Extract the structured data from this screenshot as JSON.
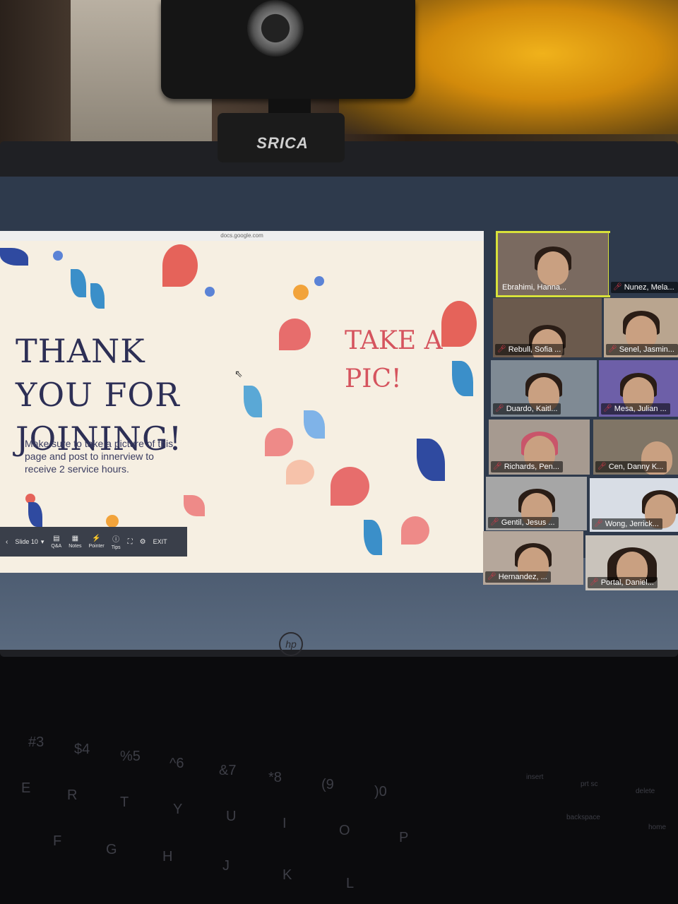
{
  "webcam": {
    "brand": "SRICA"
  },
  "browser": {
    "url": "docs.google.com"
  },
  "slide": {
    "title_lines": [
      "THANK YOU FOR",
      "JOINING!"
    ],
    "side_text_lines": [
      "TAKE A",
      "PIC!"
    ],
    "instructions": "Make sure to take a picture of this page and post to innerview to receive 2 service hours."
  },
  "toolbar": {
    "slide_label": "Slide 10",
    "buttons": [
      {
        "label": "Q&A",
        "icon": "qa-icon"
      },
      {
        "label": "Notes",
        "icon": "notes-icon"
      },
      {
        "label": "Pointer",
        "icon": "pointer-icon"
      },
      {
        "label": "Tips",
        "icon": "tips-icon"
      }
    ],
    "exit_label": "EXIT"
  },
  "participants": [
    {
      "name": "Ebrahimi, Hanna...",
      "active": true
    },
    {
      "name": "Nunez, Mela..."
    },
    {
      "name": "Rebull, Sofia ..."
    },
    {
      "name": "Senel, Jasmin..."
    },
    {
      "name": "Duardo, Kaitl..."
    },
    {
      "name": "Mesa, Julian ..."
    },
    {
      "name": "Richards, Pen..."
    },
    {
      "name": "Cen, Danny K..."
    },
    {
      "name": "Gentil, Jesus ..."
    },
    {
      "name": "Wong, Jerrick..."
    },
    {
      "name": "Hernandez, ..."
    },
    {
      "name": "Portal, Daniel..."
    }
  ],
  "keyboard": {
    "keys": [
      "#3",
      "$4",
      "%5",
      "^6",
      "&7",
      "*8",
      "(9",
      ")0",
      "E",
      "R",
      "T",
      "Y",
      "U",
      "I",
      "O",
      "P",
      "F",
      "G",
      "H",
      "J",
      "K",
      "L",
      "insert",
      "prt sc",
      "delete",
      "backspace",
      "home"
    ]
  }
}
